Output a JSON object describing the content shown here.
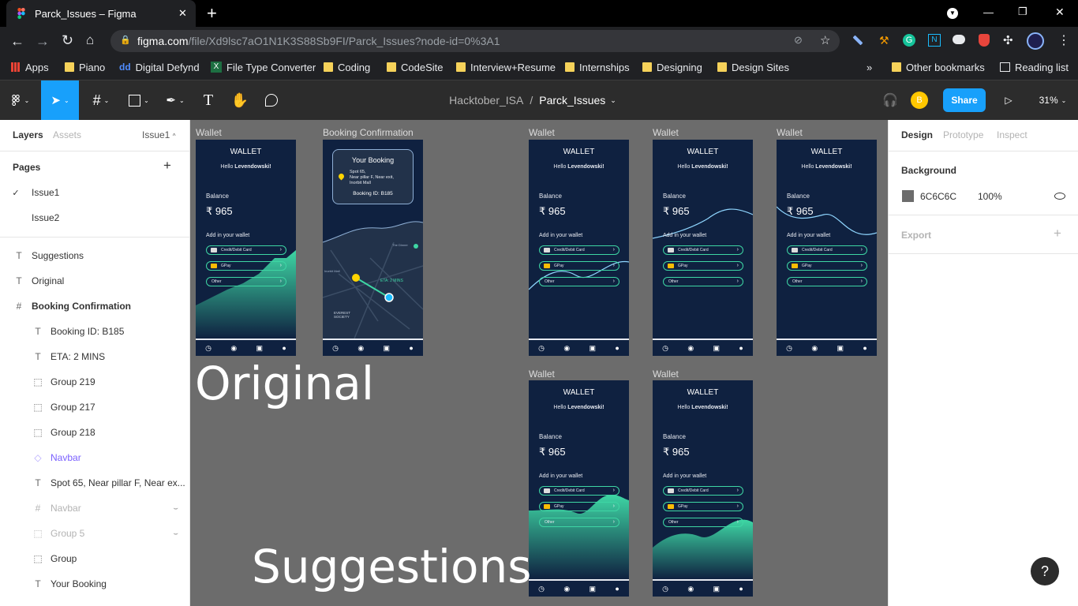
{
  "browser": {
    "tab_title": "Parck_Issues – Figma",
    "tab_close": "✕",
    "new_tab": "+",
    "url_domain": "figma.com",
    "url_path": "/file/Xd9lsc7aO1N1K3S88Sb9FI/Parck_Issues?node-id=0%3A1",
    "window_controls": [
      "—",
      "❐",
      "✕"
    ]
  },
  "bookmarks": {
    "items": [
      "Apps",
      "Piano",
      "Digital Defynd",
      "File Type Converter",
      "Coding",
      "CodeSite",
      "Interview+Resume",
      "Internships",
      "Designing",
      "Design Sites"
    ],
    "more": "»",
    "other": "Other bookmarks",
    "reading_list": "Reading list"
  },
  "figma_toolbar": {
    "project": "Hacktober_ISA",
    "separator": "/",
    "file": "Parck_Issues",
    "avatar_initial": "B",
    "share_label": "Share",
    "zoom": "31%"
  },
  "left_panel": {
    "tab_layers": "Layers",
    "tab_assets": "Assets",
    "current_page": "Issue1",
    "pages_heading": "Pages",
    "pages": [
      "Issue1",
      "Issue2"
    ],
    "layers": [
      {
        "icon": "T",
        "label": "Suggestions"
      },
      {
        "icon": "T",
        "label": "Original"
      },
      {
        "icon": "#",
        "label": "Booking Confirmation"
      },
      {
        "icon": "T",
        "label": "Booking ID: B185"
      },
      {
        "icon": "T",
        "label": "ETA: 2 MINS"
      },
      {
        "icon": "⬚",
        "label": "Group 219"
      },
      {
        "icon": "⬚",
        "label": "Group 217"
      },
      {
        "icon": "⬚",
        "label": "Group 218"
      },
      {
        "icon": "◇",
        "label": "Navbar"
      },
      {
        "icon": "T",
        "label": "Spot 65, Near pillar F, Near ex..."
      },
      {
        "icon": "#",
        "label": "Navbar"
      },
      {
        "icon": "⬚",
        "label": "Group 5"
      },
      {
        "icon": "⬚",
        "label": "Group"
      },
      {
        "icon": "T",
        "label": "Your Booking"
      }
    ]
  },
  "right_panel": {
    "tab_design": "Design",
    "tab_prototype": "Prototype",
    "tab_inspect": "Inspect",
    "background_heading": "Background",
    "bg_hex": "6C6C6C",
    "bg_opacity": "100%",
    "bg_color": "#6c6c6c",
    "export_heading": "Export"
  },
  "canvas": {
    "frame_labels": [
      "Wallet",
      "Booking Confirmation",
      "Wallet",
      "Wallet",
      "Wallet",
      "Wallet",
      "Wallet"
    ],
    "original_text": "Original",
    "suggestions_text": "Suggestions",
    "help": "?",
    "wallet": {
      "title": "WALLET",
      "hello_prefix": "Hello",
      "hello_name": "Levendowski!",
      "balance_label": "Balance",
      "balance_amount": "₹ 965",
      "add_label": "Add in your wallet",
      "options": [
        "Credit/Debit Card",
        "GPay",
        "Other"
      ]
    },
    "booking": {
      "title": "Your Booking",
      "spot": "Spot 65,",
      "line2": "Near pillar F, Near exit,",
      "line3": "Inorbit Mall",
      "id": "Booking ID: B185",
      "eta": "ETA: 2 MINS",
      "map_label_1": "EVEREST SOCIETY",
      "map_label_2": "The Dinner",
      "map_label_3": "Inorbit Mall"
    }
  }
}
